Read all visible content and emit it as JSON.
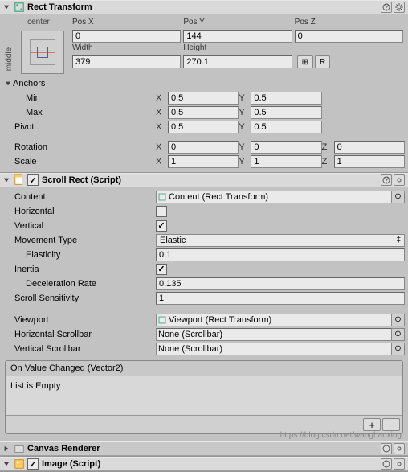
{
  "rectTransform": {
    "title": "Rect Transform",
    "anchorPreset": "center",
    "sideLabel": "middle",
    "posX": {
      "label": "Pos X",
      "value": "0"
    },
    "posY": {
      "label": "Pos Y",
      "value": "144"
    },
    "posZ": {
      "label": "Pos Z",
      "value": "0"
    },
    "width": {
      "label": "Width",
      "value": "379"
    },
    "height": {
      "label": "Height",
      "value": "270.1"
    },
    "anchorsLabel": "Anchors",
    "min": {
      "label": "Min",
      "x": "0.5",
      "y": "0.5"
    },
    "max": {
      "label": "Max",
      "x": "0.5",
      "y": "0.5"
    },
    "pivot": {
      "label": "Pivot",
      "x": "0.5",
      "y": "0.5"
    },
    "rotation": {
      "label": "Rotation",
      "x": "0",
      "y": "0",
      "z": "0"
    },
    "scale": {
      "label": "Scale",
      "x": "1",
      "y": "1",
      "z": "1"
    },
    "blueprintBtn": "⊞",
    "rawBtn": "R"
  },
  "scrollRect": {
    "title": "Scroll Rect (Script)",
    "content": {
      "label": "Content",
      "value": "Content (Rect Transform)"
    },
    "horizontal": {
      "label": "Horizontal",
      "checked": false
    },
    "vertical": {
      "label": "Vertical",
      "checked": true
    },
    "movementType": {
      "label": "Movement Type",
      "value": "Elastic"
    },
    "elasticity": {
      "label": "Elasticity",
      "value": "0.1"
    },
    "inertia": {
      "label": "Inertia",
      "checked": true
    },
    "decelerationRate": {
      "label": "Deceleration Rate",
      "value": "0.135"
    },
    "scrollSensitivity": {
      "label": "Scroll Sensitivity",
      "value": "1"
    },
    "viewport": {
      "label": "Viewport",
      "value": "Viewport (Rect Transform)"
    },
    "hScrollbar": {
      "label": "Horizontal Scrollbar",
      "value": "None (Scrollbar)"
    },
    "vScrollbar": {
      "label": "Vertical Scrollbar",
      "value": "None (Scrollbar)"
    },
    "event": {
      "header": "On Value Changed (Vector2)",
      "empty": "List is Empty"
    }
  },
  "canvasRenderer": {
    "title": "Canvas Renderer"
  },
  "image": {
    "title": "Image (Script)"
  },
  "axis": {
    "x": "X",
    "y": "Y",
    "z": "Z"
  },
  "watermark": "https://blog.csdn.net/wanghanxing"
}
